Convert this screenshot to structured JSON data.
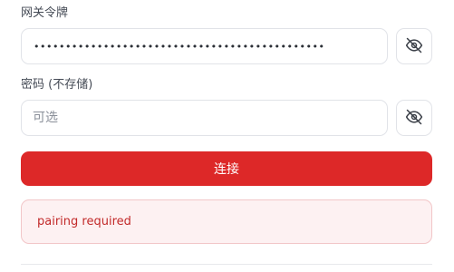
{
  "gateway_token": {
    "label": "网关令牌",
    "masked_value": "••••••••••••••••••••••••••••••••••••••••••••••",
    "toggle_icon": "eye-off-icon"
  },
  "password": {
    "label": "密码 (不存储)",
    "value": "",
    "placeholder": "可选",
    "toggle_icon": "eye-off-icon"
  },
  "connect_button": {
    "label": "连接",
    "color": "#dd2828"
  },
  "error": {
    "message": "pairing required",
    "color": "#c22a2a",
    "background": "#fdf1f2"
  }
}
